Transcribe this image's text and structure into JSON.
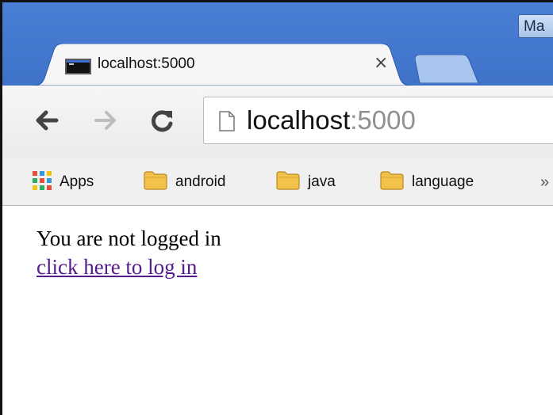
{
  "window": {
    "user_badge": "Ma"
  },
  "tab": {
    "title": "localhost:5000",
    "close_glyph": "×",
    "favicon": "terminal-icon"
  },
  "toolbar": {
    "back_icon": "back-arrow-icon",
    "forward_icon": "forward-arrow-icon",
    "reload_icon": "reload-icon",
    "url_host": "localhost",
    "url_port": ":5000"
  },
  "bookmarks": {
    "items": [
      {
        "label": "Apps",
        "icon": "apps-grid-icon"
      },
      {
        "label": "android",
        "icon": "folder-icon"
      },
      {
        "label": "java",
        "icon": "folder-icon"
      },
      {
        "label": "language",
        "icon": "folder-icon"
      }
    ],
    "more_glyph": "»"
  },
  "page": {
    "status_text": "You are not logged in",
    "login_link": "click here to log in"
  },
  "colors": {
    "titlebar": "#3f72c9",
    "visited_link": "#551a8b",
    "folder": "#f3c24a"
  }
}
